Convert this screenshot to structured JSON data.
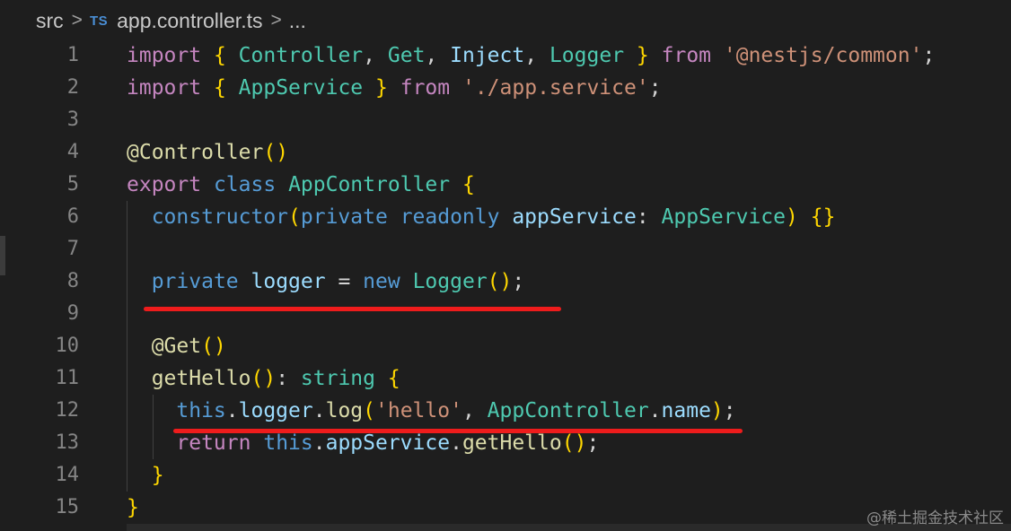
{
  "breadcrumb": {
    "root": "src",
    "separator": ">",
    "file_badge": "TS",
    "file_name": "app.controller.ts",
    "ellipsis": "..."
  },
  "code_lines": [
    {
      "num": "1",
      "text": "import { Controller, Get, Inject, Logger } from '@nestjs/common';"
    },
    {
      "num": "2",
      "text": "import { AppService } from './app.service';"
    },
    {
      "num": "3",
      "text": ""
    },
    {
      "num": "4",
      "text": "@Controller()"
    },
    {
      "num": "5",
      "text": "export class AppController {"
    },
    {
      "num": "6",
      "text": "  constructor(private readonly appService: AppService) {}"
    },
    {
      "num": "7",
      "text": ""
    },
    {
      "num": "8",
      "text": "  private logger = new Logger();"
    },
    {
      "num": "9",
      "text": ""
    },
    {
      "num": "10",
      "text": "  @Get()"
    },
    {
      "num": "11",
      "text": "  getHello(): string {"
    },
    {
      "num": "12",
      "text": "    this.logger.log('hello', AppController.name);"
    },
    {
      "num": "13",
      "text": "    return this.appService.getHello();"
    },
    {
      "num": "14",
      "text": "  }"
    },
    {
      "num": "15",
      "text": "}"
    }
  ],
  "annotations": [
    {
      "type": "red-underline",
      "under_line": "8"
    },
    {
      "type": "red-underline",
      "under_line": "12"
    }
  ],
  "colors": {
    "background": "#1e1e1e",
    "keyword": "#569cd6",
    "control_keyword": "#c586c0",
    "function": "#dcdcaa",
    "class": "#4ec9b0",
    "variable": "#9cdcfe",
    "string": "#ce9178",
    "bracket_level1": "#ffd700",
    "bracket_level2": "#da70d6",
    "bracket_level3": "#179fff",
    "underline": "#ee1c1c"
  },
  "watermark": "@稀土掘金技术社区"
}
